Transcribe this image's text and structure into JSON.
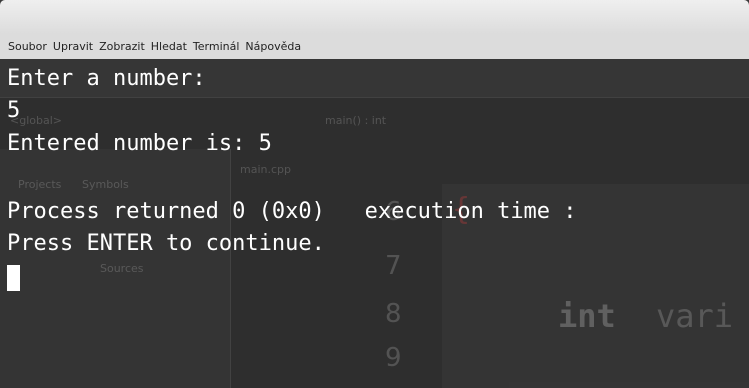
{
  "menubar": {
    "items": [
      "Soubor",
      "Upravit",
      "Zobrazit",
      "Hledat",
      "Terminál",
      "Nápověda"
    ]
  },
  "terminal": {
    "lines": [
      "Enter a number:",
      "5",
      "Entered number is: 5",
      "",
      "Process returned 0 (0x0)   execution time :",
      "Press ENTER to continue."
    ]
  },
  "background_ide": {
    "combo_label": "<global>",
    "file_label": "main() : int",
    "tab_label": "main.cpp",
    "panel_tabs": [
      "Projects",
      "Symbols"
    ],
    "tree_item": "Sources",
    "line_numbers": [
      "6",
      "7",
      "8",
      "9"
    ],
    "code_keyword": "int",
    "code_text": "vari"
  },
  "colors": {
    "terminal_bg": "#2e2e2e",
    "terminal_fg": "#ffffff",
    "menubar_bg": "#dcdcdc"
  }
}
